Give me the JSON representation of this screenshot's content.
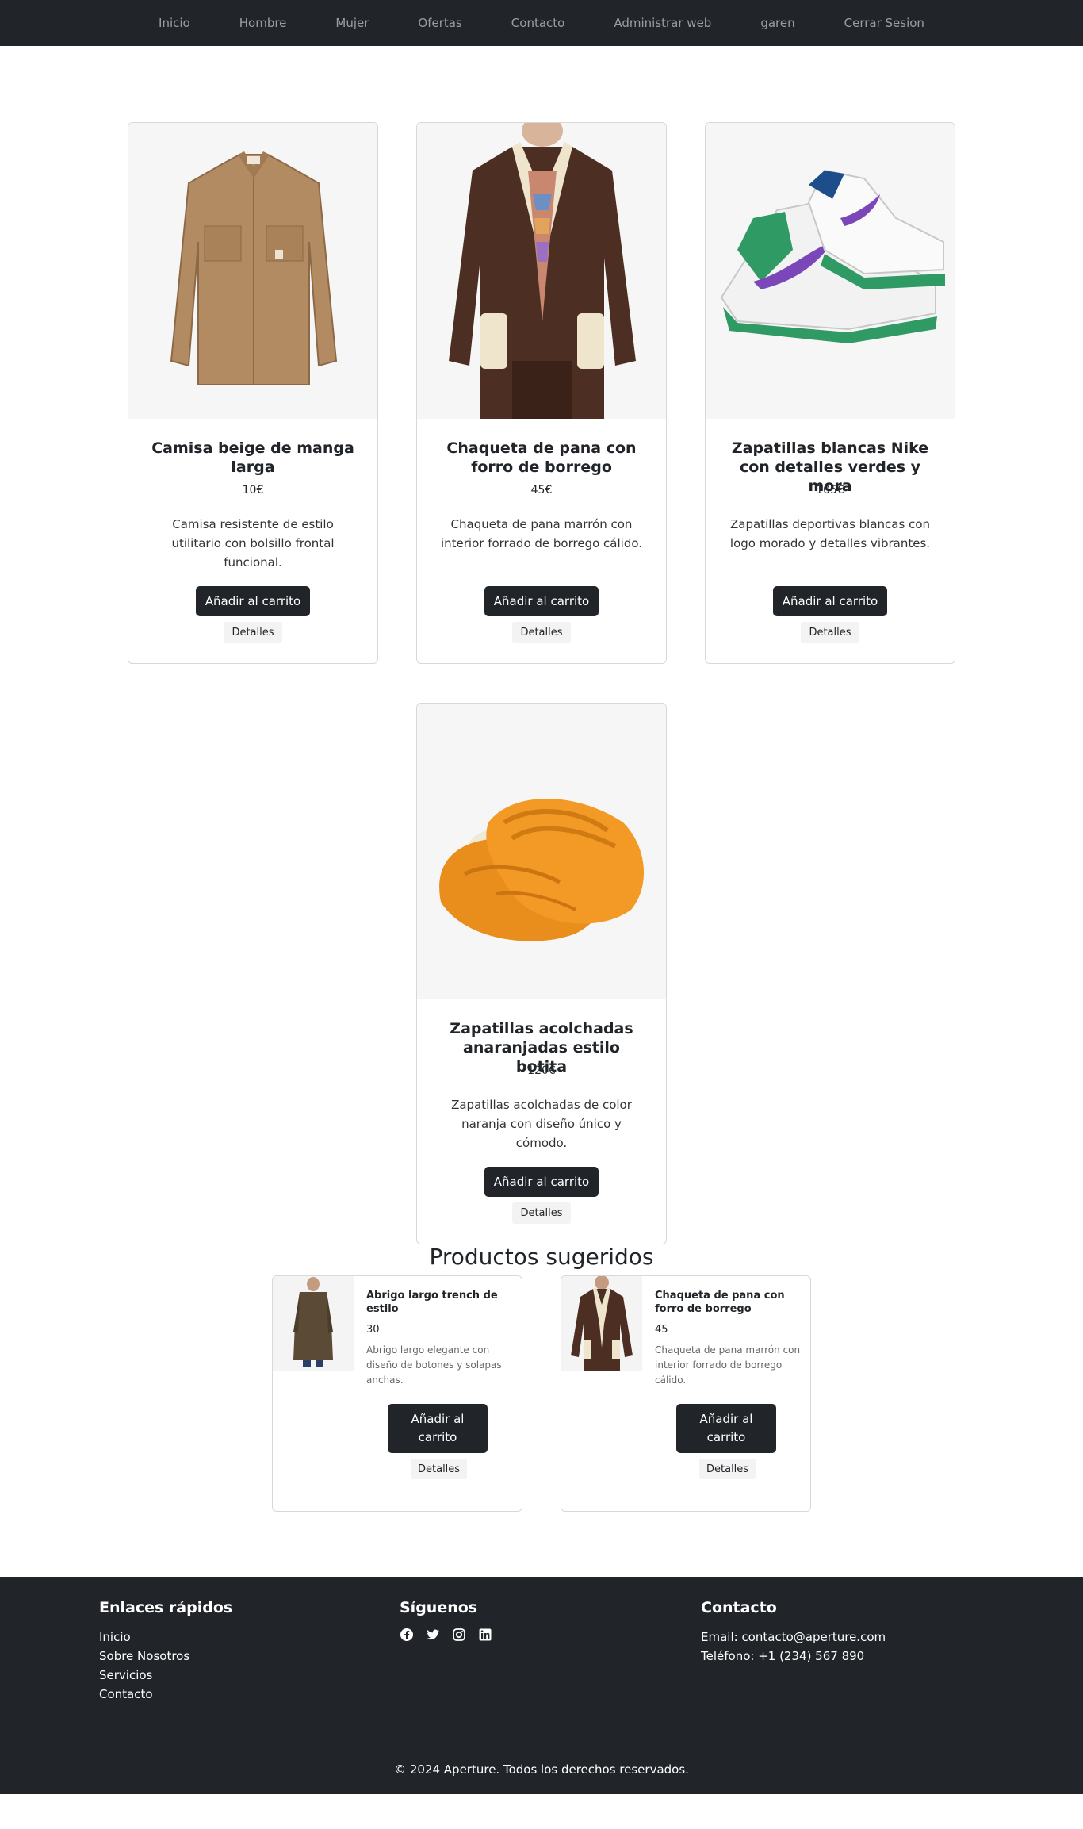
{
  "nav": {
    "items": [
      "Inicio",
      "Hombre",
      "Mujer",
      "Ofertas",
      "Contacto",
      "Administrar web",
      "garen",
      "Cerrar Sesion"
    ]
  },
  "products": [
    {
      "title": "Camisa beige de manga larga",
      "price": "10€",
      "description": "Camisa resistente de estilo utilitario con bolsillo frontal funcional.",
      "cart_label": "Añadir al carrito",
      "details_label": "Detalles",
      "image": "beige-shirt"
    },
    {
      "title": "Chaqueta de pana con forro de borrego",
      "price": "45€",
      "description": "Chaqueta de pana marrón con interior forrado de borrego cálido.",
      "cart_label": "Añadir al carrito",
      "details_label": "Detalles",
      "image": "corduroy-jacket"
    },
    {
      "title": "Zapatillas blancas Nike con detalles verdes y mora",
      "price": "105€",
      "description": "Zapatillas deportivas blancas con logo morado y detalles vibrantes.",
      "cart_label": "Añadir al carrito",
      "details_label": "Detalles",
      "image": "white-sneakers"
    },
    {
      "title": "Zapatillas acolchadas anaranjadas estilo botita",
      "price": "120€",
      "description": "Zapatillas acolchadas de color naranja con diseño único y cómodo.",
      "cart_label": "Añadir al carrito",
      "details_label": "Detalles",
      "image": "orange-puffy-shoes"
    }
  ],
  "suggested": {
    "heading": "Productos sugeridos",
    "items": [
      {
        "title": "Abrigo largo trench de estilo",
        "price": "30",
        "description": "Abrigo largo elegante con diseño de botones y solapas anchas.",
        "cart_label_line1": "Añadir al",
        "cart_label_line2": "carrito",
        "details_label": "Detalles",
        "image": "trench-coat"
      },
      {
        "title": "Chaqueta de pana con forro de borrego",
        "price": "45",
        "description": "Chaqueta de pana marrón con interior forrado de borrego cálido.",
        "cart_label_line1": "Añadir al",
        "cart_label_line2": "carrito",
        "details_label": "Detalles",
        "image": "corduroy-jacket"
      }
    ]
  },
  "footer": {
    "quick_links_title": "Enlaces rápidos",
    "quick_links": [
      "Inicio",
      "Sobre Nosotros",
      "Servicios",
      "Contacto"
    ],
    "follow_title": "Síguenos",
    "socials": [
      "facebook-icon",
      "twitter-icon",
      "instagram-icon",
      "linkedin-icon"
    ],
    "contact_title": "Contacto",
    "email": "Email: contacto@aperture.com",
    "phone": "Teléfono: +1 (234) 567 890",
    "copyright": "© 2024 Aperture. Todos los derechos reservados."
  },
  "colors": {
    "dark": "#212529",
    "nav_link": "#8f9296",
    "image_bg": "#f6f6f6"
  }
}
